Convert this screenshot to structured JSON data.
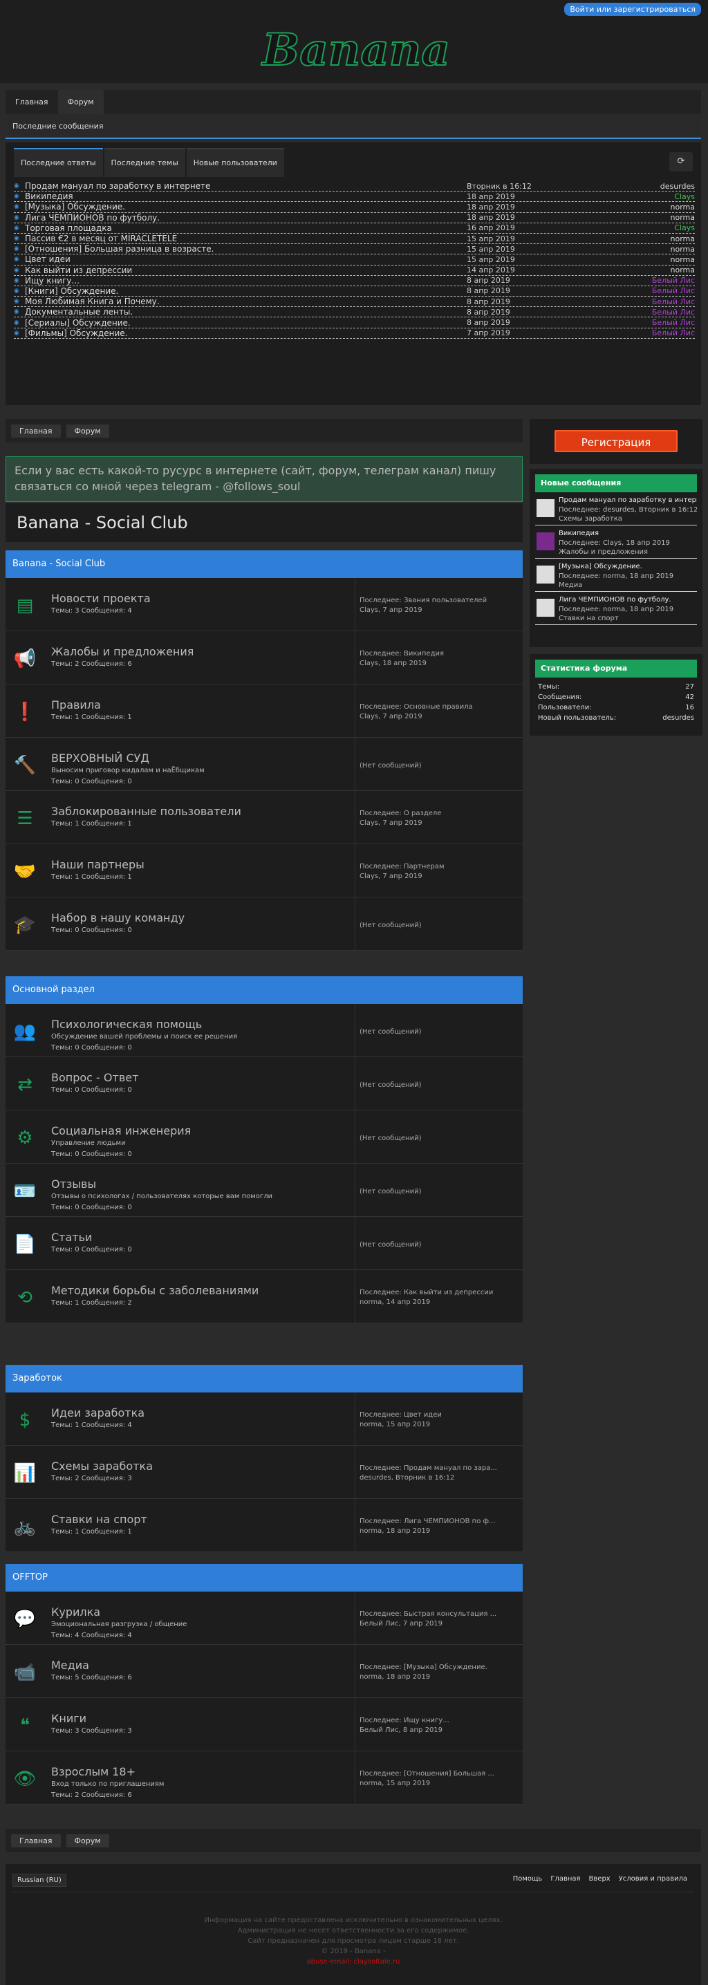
{
  "header": {
    "login": "Войти или зарегистрироваться",
    "logo_text": "Banana"
  },
  "topnav": [
    "Главная",
    "Форум"
  ],
  "subnav": "Последние сообщения",
  "recent_tabs": [
    "Последние ответы",
    "Последние темы",
    "Новые пользователи"
  ],
  "recent": [
    {
      "title": "Продам мануал по заработку в интернете",
      "date": "Вторник в 16:12",
      "user": "desurdes",
      "color": "#dddddd"
    },
    {
      "title": "Википедия",
      "date": "18 апр 2019",
      "user": "Clays",
      "color": "#45c25a"
    },
    {
      "title": "[Музыка] Обсуждение.",
      "date": "18 апр 2019",
      "user": "norma",
      "color": "#dddddd"
    },
    {
      "title": "Лига ЧЕМПИОНОВ по футболу.",
      "date": "18 апр 2019",
      "user": "norma",
      "color": "#dddddd"
    },
    {
      "title": "Торговая площадка",
      "date": "16 апр 2019",
      "user": "Clays",
      "color": "#45c25a"
    },
    {
      "title": "Пассив €2 в месяц от MIRACLETELE",
      "date": "15 апр 2019",
      "user": "norma",
      "color": "#dddddd"
    },
    {
      "title": "[Отношения] Большая разница в возрасте.",
      "date": "15 апр 2019",
      "user": "norma",
      "color": "#dddddd"
    },
    {
      "title": "Цвет идеи",
      "date": "15 апр 2019",
      "user": "norma",
      "color": "#dddddd"
    },
    {
      "title": "Как выйти из депрессии",
      "date": "14 апр 2019",
      "user": "norma",
      "color": "#dddddd"
    },
    {
      "title": "Ищу книгу...",
      "date": "8 апр 2019",
      "user": "Белый Лис",
      "color": "#b040d8"
    },
    {
      "title": "[Книги] Обсуждение.",
      "date": "8 апр 2019",
      "user": "Белый Лис",
      "color": "#b040d8"
    },
    {
      "title": "Моя Любимая Книга и Почему.",
      "date": "8 апр 2019",
      "user": "Белый Лис",
      "color": "#b040d8"
    },
    {
      "title": "Документальные ленты.",
      "date": "8 апр 2019",
      "user": "Белый Лис",
      "color": "#b040d8"
    },
    {
      "title": "[Сериалы] Обсуждение.",
      "date": "8 апр 2019",
      "user": "Белый Лис",
      "color": "#b040d8"
    },
    {
      "title": "[Фильмы] Обсуждение.",
      "date": "7 апр 2019",
      "user": "Белый Лис",
      "color": "#b040d8"
    }
  ],
  "breadcrumb": [
    "Главная",
    "Форум"
  ],
  "announce": "Если у вас есть какой-то русурс в интернете (сайт, форум, телеграм канал) пишу связаться со мной через telegram - @follows_soul",
  "forum_title": "Banana - Social Club",
  "categories": [
    {
      "name": "Banana - Social Club",
      "nodes": [
        {
          "icon": "newspaper-icon",
          "glyph": "▤",
          "title": "Новости проекта",
          "desc": "",
          "stats": "Темы: 3 Сообщения: 4",
          "last": "Последнее: Звания пользователей",
          "last2": "Clays, 7 апр 2019"
        },
        {
          "icon": "megaphone-icon",
          "glyph": "📢",
          "title": "Жалобы и предложения",
          "desc": "",
          "stats": "Темы: 2 Сообщения: 6",
          "last": "Последнее: Википедия",
          "last2": "Clays, 18 апр 2019"
        },
        {
          "icon": "exclamation-icon",
          "glyph": "❗",
          "title": "Правила",
          "desc": "",
          "stats": "Темы: 1 Сообщения: 1",
          "last": "Последнее: Основные правила",
          "last2": "Clays, 7 апр 2019"
        },
        {
          "icon": "gavel-icon",
          "glyph": "🔨",
          "title": "ВЕРХОВНЫЙ СУД",
          "desc": "Выносим приговор кидалам и наЁбщикам",
          "stats": "Темы: 0 Сообщения: 0",
          "last": "(Нет сообщений)",
          "last2": ""
        },
        {
          "icon": "list-icon",
          "glyph": "☰",
          "title": "Заблокированные пользователи",
          "desc": "",
          "stats": "Темы: 1 Сообщения: 1",
          "last": "Последнее: О разделе",
          "last2": "Clays, 7 апр 2019"
        },
        {
          "icon": "handshake-icon",
          "glyph": "🤝",
          "title": "Наши партнеры",
          "desc": "",
          "stats": "Темы: 1 Сообщения: 1",
          "last": "Последнее: Партнерам",
          "last2": "Clays, 7 апр 2019"
        },
        {
          "icon": "graduation-cap-icon",
          "glyph": "🎓",
          "title": "Набор в нашу команду",
          "desc": "",
          "stats": "Темы: 0 Сообщения: 0",
          "last": "(Нет сообщений)",
          "last2": ""
        }
      ]
    },
    {
      "name": "Основной раздел",
      "nodes": [
        {
          "icon": "users-icon",
          "glyph": "👥",
          "title": "Психологическая помощь",
          "desc": "Обсуждение вашей проблемы и поиск ее решения",
          "stats": "Темы: 0 Сообщения: 0",
          "last": "(Нет сообщений)",
          "last2": ""
        },
        {
          "icon": "exchange-icon",
          "glyph": "⇄",
          "title": "Вопрос - Ответ",
          "desc": "",
          "stats": "Темы: 0 Сообщения: 0",
          "last": "(Нет сообщений)",
          "last2": ""
        },
        {
          "icon": "cogs-icon",
          "glyph": "⚙",
          "title": "Социальная инженерия",
          "desc": "Управление людьми",
          "stats": "Темы: 0 Сообщения: 0",
          "last": "(Нет сообщений)",
          "last2": ""
        },
        {
          "icon": "id-card-icon",
          "glyph": "🪪",
          "title": "Отзывы",
          "desc": "Отзывы о психологах / пользователях которые вам помогли",
          "stats": "Темы: 0 Сообщения: 0",
          "last": "(Нет сообщений)",
          "last2": ""
        },
        {
          "icon": "document-icon",
          "glyph": "📄",
          "title": "Статьи",
          "desc": "",
          "stats": "Темы: 0 Сообщения: 0",
          "last": "(Нет сообщений)",
          "last2": ""
        },
        {
          "icon": "retweet-icon",
          "glyph": "⟲",
          "title": "Методики борьбы с заболеваниями",
          "desc": "",
          "stats": "Темы: 1 Сообщения: 2",
          "last": "Последнее: Как выйти из депрессии",
          "last2": "norma, 14 апр 2019"
        }
      ]
    },
    {
      "name": "Заработок",
      "nodes": [
        {
          "icon": "dollar-icon",
          "glyph": "$",
          "title": "Идеи заработка",
          "desc": "",
          "stats": "Темы: 1 Сообщения: 4",
          "last": "Последнее: Цвет идеи",
          "last2": "norma, 15 апр 2019"
        },
        {
          "icon": "bar-chart-icon",
          "glyph": "📊",
          "title": "Схемы заработка",
          "desc": "",
          "stats": "Темы: 2 Сообщения: 3",
          "last": "Последнее: Продам мануал по зара...",
          "last2": "desurdes, Вторник в 16:12"
        },
        {
          "icon": "bicycle-icon",
          "glyph": "🚲",
          "title": "Ставки на спорт",
          "desc": "",
          "stats": "Темы: 1 Сообщения: 1",
          "last": "Последнее: Лига ЧЕМПИОНОВ по ф...",
          "last2": "norma, 18 апр 2019"
        }
      ]
    },
    {
      "name": "OFFTOP",
      "nodes": [
        {
          "icon": "comment-icon",
          "glyph": "💬",
          "title": "Курилка",
          "desc": "Эмоциональная разгрузка / общение",
          "stats": "Темы: 4 Сообщения: 4",
          "last": "Последнее: Быстрая консультация ...",
          "last2": "Белый Лис, 7 апр 2019"
        },
        {
          "icon": "video-camera-icon",
          "glyph": "📹",
          "title": "Медиа",
          "desc": "",
          "stats": "Темы: 5 Сообщения: 6",
          "last": "Последнее: [Музыка] Обсуждение.",
          "last2": "norma, 18 апр 2019"
        },
        {
          "icon": "quote-icon",
          "glyph": "❝",
          "title": "Книги",
          "desc": "",
          "stats": "Темы: 3 Сообщения: 3",
          "last": "Последнее: Ищу книгу...",
          "last2": "Белый Лис, 8 апр 2019"
        },
        {
          "icon": "eye-slash-icon",
          "glyph": "👁",
          "title": "Взрослым 18+",
          "desc": "Вход только по приглашениям",
          "stats": "Темы: 2 Сообщения: 6",
          "last": "Последнее: [Отношения] Большая ...",
          "last2": "norma, 15 апр 2019"
        }
      ]
    }
  ],
  "sidebar": {
    "register": "Регистрация",
    "new_posts_title": "Новые сообщения",
    "new_posts": [
      {
        "title": "Продам мануал по заработку в интерне...",
        "meta": "Последнее: desurdes, Вторник в 16:12",
        "cat": "Схемы заработка"
      },
      {
        "title": "Википедия",
        "meta": "Последнее: Clays, 18 апр 2019",
        "cat": "Жалобы и предложения"
      },
      {
        "title": "[Музыка] Обсуждение.",
        "meta": "Последнее: norma, 18 апр 2019",
        "cat": "Медиа"
      },
      {
        "title": "Лига ЧЕМПИОНОВ по футболу.",
        "meta": "Последнее: norma, 18 апр 2019",
        "cat": "Ставки на спорт"
      }
    ],
    "stats_title": "Статистика форума",
    "stats": [
      {
        "label": "Темы:",
        "value": "27"
      },
      {
        "label": "Сообщения:",
        "value": "42"
      },
      {
        "label": "Пользователи:",
        "value": "16"
      },
      {
        "label": "Новый пользователь:",
        "value": "desurdes"
      }
    ]
  },
  "footer": {
    "lang": "Russian (RU)",
    "links": [
      "Помощь",
      "Главная",
      "Вверх",
      "Условия и правила"
    ],
    "note": [
      "Информация на сайте предоставлена исключительно в ознакомительных целях.",
      "Администрация не несет ответственности за его содержимое.",
      "Сайт предназначен для просмотра лицам старше 18 лет.",
      "© 2019 - Banana -",
      "abuse-email: claysoltale.ru"
    ]
  }
}
